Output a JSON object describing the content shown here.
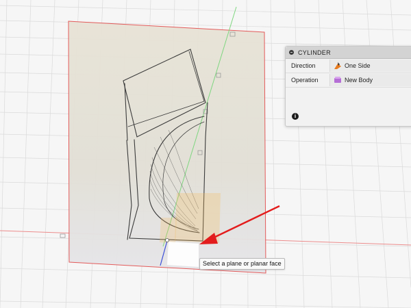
{
  "dialog": {
    "title": "CYLINDER",
    "rows": [
      {
        "label": "Direction",
        "value": "One Side",
        "icon": "one-side-direction-icon"
      },
      {
        "label": "Operation",
        "value": "New Body",
        "icon": "new-body-icon"
      }
    ],
    "info_icon": "info-icon"
  },
  "tooltip": "Select a plane or planar face",
  "colors": {
    "background": "#f6f6f6",
    "grid": "#d8d8d8",
    "canvas_border": "#e25252",
    "canvas_fill": "#ece7db",
    "x_axis": "#e8797a",
    "y_axis": "#35c23a",
    "z_axis": "#3b4ed8",
    "annotation_arrow": "#e31c1c",
    "highlight": "#f3b95a"
  }
}
